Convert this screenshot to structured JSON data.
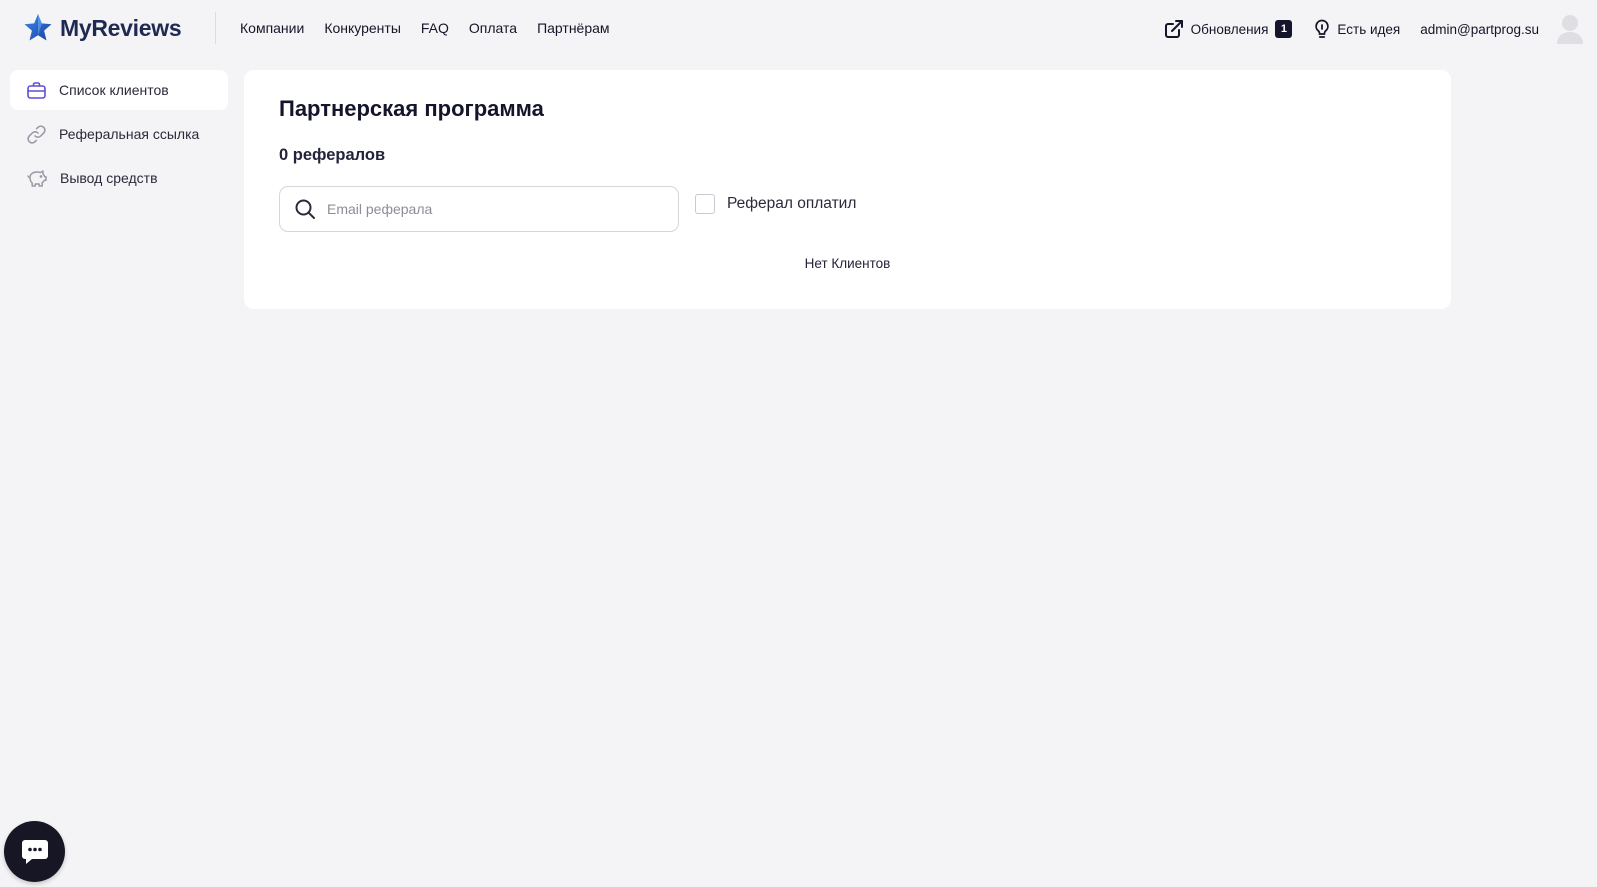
{
  "header": {
    "logo_text": "MyReviews",
    "nav": [
      {
        "label": "Компании"
      },
      {
        "label": "Конкуренты"
      },
      {
        "label": "FAQ"
      },
      {
        "label": "Оплата"
      },
      {
        "label": "Партнёрам"
      }
    ],
    "updates_label": "Обновления",
    "updates_count": "1",
    "idea_label": "Есть идея",
    "user_email": "admin@partprog.su"
  },
  "sidebar": {
    "items": [
      {
        "label": "Список клиентов",
        "icon": "briefcase-icon",
        "active": true
      },
      {
        "label": "Реферальная ссылка",
        "icon": "link-icon",
        "active": false
      },
      {
        "label": "Вывод средств",
        "icon": "piggy-bank-icon",
        "active": false
      }
    ]
  },
  "main": {
    "title": "Партнерская программа",
    "ref_count": "0 рефералов",
    "search_placeholder": "Email реферала",
    "search_value": "",
    "checkbox_label": "Реферал оплатил",
    "checkbox_checked": false,
    "empty_text": "Нет Клиентов"
  },
  "colors": {
    "background": "#f4f4f6",
    "card": "#ffffff",
    "logo_star": "#2b63d9",
    "accent_dark": "#14142b"
  }
}
